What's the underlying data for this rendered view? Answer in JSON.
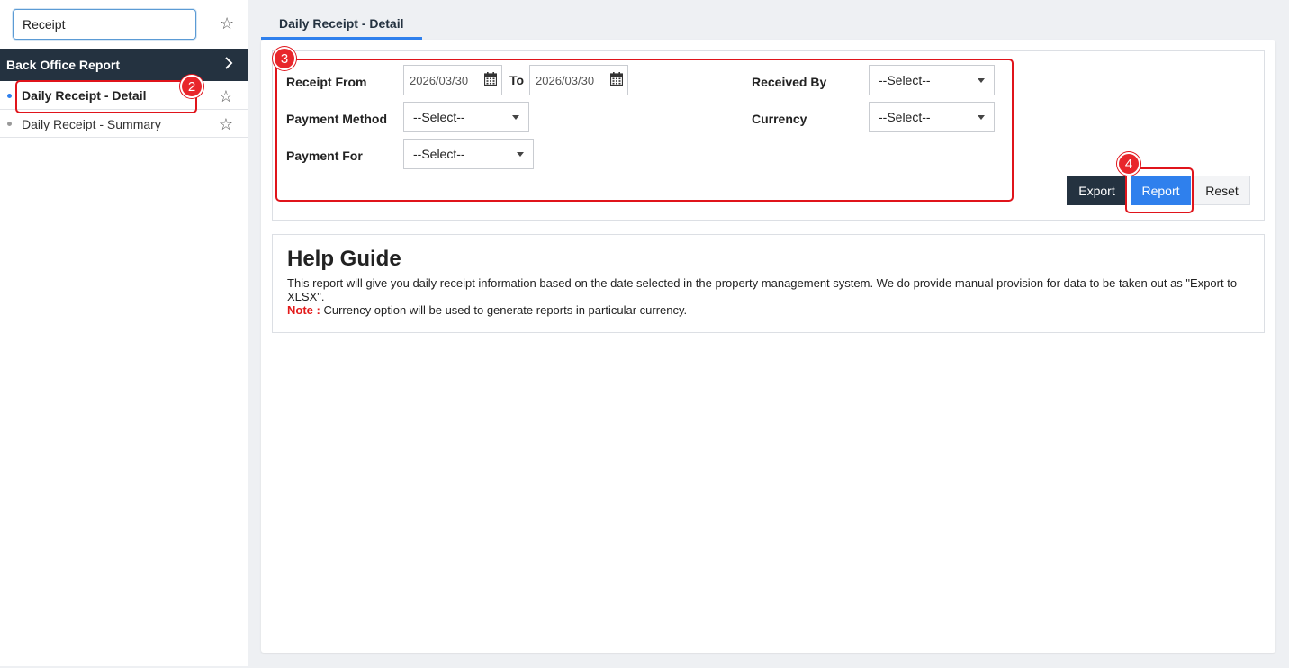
{
  "sidebar": {
    "search": {
      "value": "Receipt",
      "placeholder": ""
    },
    "section_title": "Back Office Report",
    "items": [
      {
        "label": "Daily Receipt - Detail",
        "active": true
      },
      {
        "label": "Daily Receipt - Summary",
        "active": false
      }
    ]
  },
  "tab": {
    "label": "Daily Receipt - Detail"
  },
  "filters": {
    "receipt_from_label": "Receipt From",
    "receipt_from_value": "2026/03/30",
    "to_label": "To",
    "to_value": "2026/03/30",
    "received_by_label": "Received By",
    "received_by_value": "--Select--",
    "payment_method_label": "Payment Method",
    "payment_method_value": "--Select--",
    "currency_label": "Currency",
    "currency_value": "--Select--",
    "payment_for_label": "Payment For",
    "payment_for_value": "--Select--"
  },
  "buttons": {
    "export": "Export",
    "report": "Report",
    "reset": "Reset"
  },
  "help": {
    "title": "Help Guide",
    "text": "This report will give you daily receipt information based on the date selected in the property management system. We do provide manual provision for data to be taken out as \"Export to XLSX\".",
    "note_label": "Note :",
    "note_text": " Currency option will be used to generate reports in particular currency."
  },
  "annotations": {
    "badge_2": "2",
    "badge_3": "3",
    "badge_4": "4"
  },
  "colors": {
    "accent": "#2f80ed",
    "dark": "#243240",
    "annotation": "#e0141b",
    "note": "#e31b1b"
  },
  "icons": {
    "favorite": "star-icon",
    "expand": "chevron-right-icon",
    "calendar": "calendar-icon",
    "dropdown": "caret-down-icon"
  }
}
